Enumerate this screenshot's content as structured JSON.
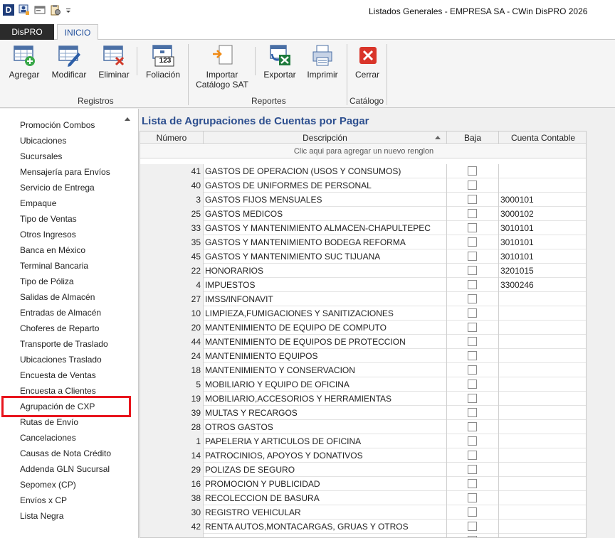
{
  "window": {
    "title": "Listados Generales - EMPRESA SA - CWin DisPRO 2026",
    "app_icon_letter": "D"
  },
  "tabs": {
    "dispro": "DisPRO",
    "inicio": "INICIO"
  },
  "ribbon": {
    "buttons": {
      "agregar": "Agregar",
      "modificar": "Modificar",
      "eliminar": "Eliminar",
      "foliacion": "Foliación",
      "importar_l1": "Importar",
      "importar_l2": "Catálogo SAT",
      "exportar": "Exportar",
      "imprimir": "Imprimir",
      "cerrar": "Cerrar"
    },
    "groups": {
      "registros": "Registros",
      "reportes": "Reportes",
      "catalogo": "Catálogo"
    },
    "foliacion_number": "123"
  },
  "sidebar": {
    "items": [
      "Promoción Combos",
      "Ubicaciones",
      "Sucursales",
      "Mensajería para Envíos",
      "Servicio de Entrega",
      "Empaque",
      "Tipo de Ventas",
      "Otros Ingresos",
      "Banca en México",
      "Terminal Bancaria",
      "Tipo de Póliza",
      "Salidas de Almacén",
      "Entradas de Almacén",
      "Choferes de Reparto",
      "Transporte de Traslado",
      "Ubicaciones Traslado",
      "Encuesta de Ventas",
      "Encuesta a Clientes",
      "Agrupación de CXP",
      "Rutas de Envío",
      "Cancelaciones",
      "Causas de Nota Crédito",
      "Addenda GLN Sucursal",
      "Sepomex (CP)",
      "Envíos x CP",
      "Lista Negra"
    ],
    "selected": "Agrupación de CXP",
    "highlight_color": "#e8141c"
  },
  "main": {
    "title": "Lista de Agrupaciones de Cuentas por Pagar",
    "columns": {
      "numero": "Número",
      "descripcion": "Descripción",
      "baja": "Baja",
      "cuenta": "Cuenta Contable"
    },
    "new_row_text": "Clic aqui para agregar un nuevo renglon",
    "rows": [
      {
        "num": "41",
        "desc": "GASTOS DE OPERACION (USOS Y CONSUMOS)",
        "cuenta": ""
      },
      {
        "num": "40",
        "desc": "GASTOS DE UNIFORMES DE PERSONAL",
        "cuenta": ""
      },
      {
        "num": "3",
        "desc": "GASTOS FIJOS  MENSUALES",
        "cuenta": "3000101"
      },
      {
        "num": "25",
        "desc": "GASTOS MEDICOS",
        "cuenta": "3000102"
      },
      {
        "num": "33",
        "desc": "GASTOS Y MANTENIMIENTO ALMACEN-CHAPULTEPEC",
        "cuenta": "3010101"
      },
      {
        "num": "35",
        "desc": "GASTOS Y MANTENIMIENTO BODEGA REFORMA",
        "cuenta": "3010101"
      },
      {
        "num": "45",
        "desc": "GASTOS Y MANTENIMIENTO SUC TIJUANA",
        "cuenta": "3010101"
      },
      {
        "num": "22",
        "desc": "HONORARIOS",
        "cuenta": "3201015"
      },
      {
        "num": "4",
        "desc": "IMPUESTOS",
        "cuenta": "3300246"
      },
      {
        "num": "27",
        "desc": "IMSS/INFONAVIT",
        "cuenta": ""
      },
      {
        "num": "10",
        "desc": "LIMPIEZA,FUMIGACIONES Y SANITIZACIONES",
        "cuenta": ""
      },
      {
        "num": "20",
        "desc": "MANTENIMIENTO DE EQUIPO DE COMPUTO",
        "cuenta": ""
      },
      {
        "num": "44",
        "desc": "MANTENIMIENTO DE EQUIPOS DE PROTECCION",
        "cuenta": ""
      },
      {
        "num": "24",
        "desc": "MANTENIMIENTO EQUIPOS",
        "cuenta": ""
      },
      {
        "num": "18",
        "desc": "MANTENIMIENTO Y CONSERVACION",
        "cuenta": ""
      },
      {
        "num": "5",
        "desc": "MOBILIARIO Y EQUIPO DE OFICINA",
        "cuenta": ""
      },
      {
        "num": "19",
        "desc": "MOBILIARIO,ACCESORIOS Y HERRAMIENTAS",
        "cuenta": ""
      },
      {
        "num": "39",
        "desc": "MULTAS Y RECARGOS",
        "cuenta": ""
      },
      {
        "num": "28",
        "desc": "OTROS GASTOS",
        "cuenta": ""
      },
      {
        "num": "1",
        "desc": "PAPELERIA Y ARTICULOS DE OFICINA",
        "cuenta": ""
      },
      {
        "num": "14",
        "desc": "PATROCINIOS, APOYOS Y DONATIVOS",
        "cuenta": ""
      },
      {
        "num": "29",
        "desc": "POLIZAS DE SEGURO",
        "cuenta": ""
      },
      {
        "num": "16",
        "desc": "PROMOCION Y PUBLICIDAD",
        "cuenta": ""
      },
      {
        "num": "38",
        "desc": "RECOLECCION DE BASURA",
        "cuenta": ""
      },
      {
        "num": "30",
        "desc": "REGISTRO VEHICULAR",
        "cuenta": ""
      },
      {
        "num": "42",
        "desc": "RENTA AUTOS,MONTACARGAS, GRUAS Y OTROS",
        "cuenta": ""
      },
      {
        "num": "",
        "desc": "",
        "cuenta": ""
      }
    ]
  }
}
